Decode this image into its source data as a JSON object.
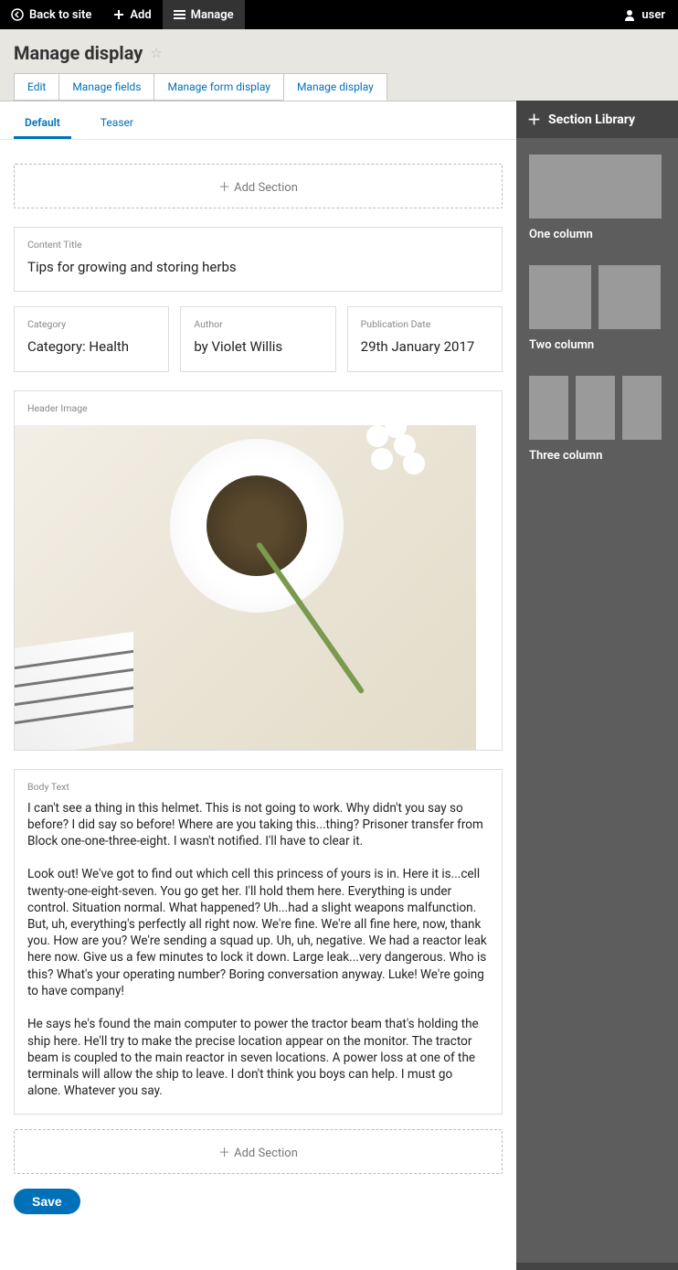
{
  "topbar": {
    "back": "Back to site",
    "add": "Add",
    "manage": "Manage",
    "user": "user"
  },
  "page_title": "Manage display",
  "primary_tabs": {
    "edit": "Edit",
    "manage_fields": "Manage fields",
    "manage_form_display": "Manage form display",
    "manage_display": "Manage display"
  },
  "secondary_tabs": {
    "default": "Default",
    "teaser": "Teaser"
  },
  "add_section_label": "Add Section",
  "blocks": {
    "content_title": {
      "label": "Content Title",
      "value": "Tips for growing and storing herbs"
    },
    "category": {
      "label": "Category",
      "value": "Category: Health"
    },
    "author": {
      "label": "Author",
      "value": "by Violet Willis"
    },
    "pub_date": {
      "label": "Publication Date",
      "value": "29th January 2017"
    },
    "header_image": {
      "label": "Header Image"
    },
    "body_text": {
      "label": "Body Text",
      "value": "I can't see a thing in this helmet. This is not going to work. Why didn't you say so before? I did say so before! Where are you taking this...thing? Prisoner transfer from Block one-one-three-eight. I wasn't notified. I'll have to clear it.\n\nLook out! We've got to find out which cell this princess of yours is in. Here it is...cell twenty-one-eight-seven. You go get her. I'll hold them here. Everything is under control. Situation normal. What happened? Uh...had a slight weapons malfunction. But, uh, everything's perfectly all right now. We're fine. We're all fine here, now, thank you. How are you? We're sending a squad up. Uh, uh, negative. We had a reactor leak here now. Give us a few minutes to lock it down. Large leak...very dangerous. Who is this? What's your operating number? Boring conversation anyway. Luke! We're going to have company!\n\nHe says he's found the main computer to power the tractor beam that's holding the ship here. He'll try to make the precise location appear on the monitor. The tractor beam is coupled to the main reactor in seven locations. A power loss at one of the terminals will allow the ship to leave. I don't think you boys can help. I must go alone. Whatever you say."
    }
  },
  "save_label": "Save",
  "sidebar": {
    "title": "Section Library",
    "one_column": "One column",
    "two_column": "Two column",
    "three_column": "Three column"
  }
}
